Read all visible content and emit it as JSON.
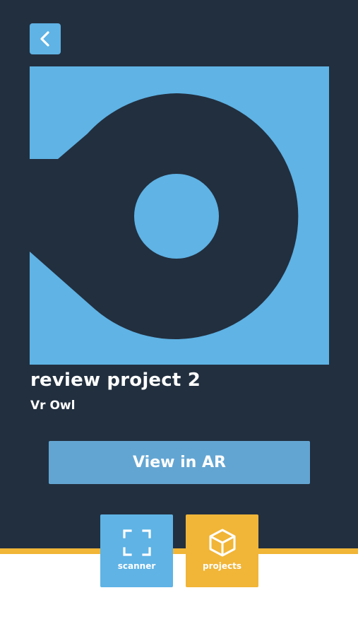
{
  "colors": {
    "background_dark": "#222f3f",
    "accent_blue": "#5fb3e5",
    "button_blue": "#63a5d2",
    "accent_gold": "#f1b537"
  },
  "header": {
    "back_icon": "chevron-left-icon"
  },
  "project": {
    "preview_icon": "project-logo-image",
    "title": "review project 2",
    "subtitle": "Vr Owl"
  },
  "actions": {
    "view_ar_label": "View in AR"
  },
  "tabbar": {
    "items": [
      {
        "label": "scanner",
        "icon": "scan-frame-icon",
        "active": false
      },
      {
        "label": "projects",
        "icon": "cube-icon",
        "active": true
      }
    ]
  }
}
